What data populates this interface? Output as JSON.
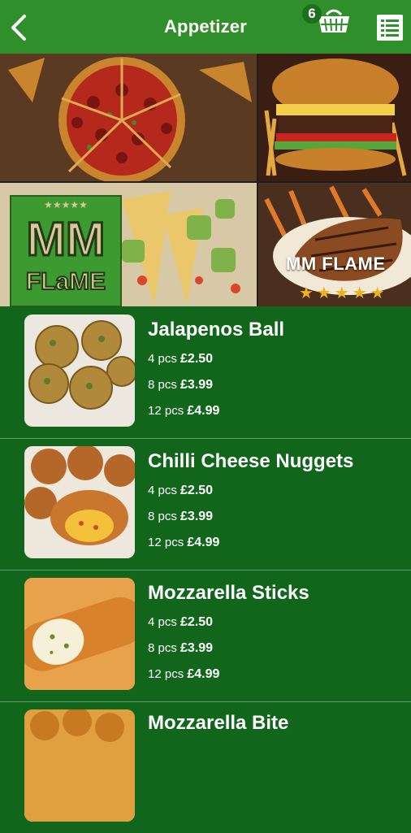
{
  "header": {
    "title": "Appetizer",
    "cart_count": "6",
    "icons": [
      "back-arrow-icon",
      "basket-icon",
      "list-menu-icon"
    ]
  },
  "banner": {
    "logo_line1": "MM",
    "logo_line2": "FLaME",
    "caption": "MM FLAME",
    "stars": "★★★★★"
  },
  "items": [
    {
      "name": "Jalapenos Ball",
      "prices": [
        {
          "qty": "4 pcs",
          "price": "£2.50"
        },
        {
          "qty": "8 pcs",
          "price": "£3.99"
        },
        {
          "qty": "12 pcs",
          "price": "£4.99"
        }
      ]
    },
    {
      "name": "Chilli Cheese Nuggets",
      "prices": [
        {
          "qty": "4 pcs",
          "price": "£2.50"
        },
        {
          "qty": "8 pcs",
          "price": "£3.99"
        },
        {
          "qty": "12 pcs",
          "price": "£4.99"
        }
      ]
    },
    {
      "name": "Mozzarella Sticks",
      "prices": [
        {
          "qty": "4 pcs",
          "price": "£2.50"
        },
        {
          "qty": "8 pcs",
          "price": "£3.99"
        },
        {
          "qty": "12 pcs",
          "price": "£4.99"
        }
      ]
    },
    {
      "name": "Mozzarella Bite",
      "prices": []
    }
  ],
  "colors": {
    "header_green": "#2f8f2a",
    "list_green": "#11661c",
    "star_gold": "#f0b21c"
  }
}
